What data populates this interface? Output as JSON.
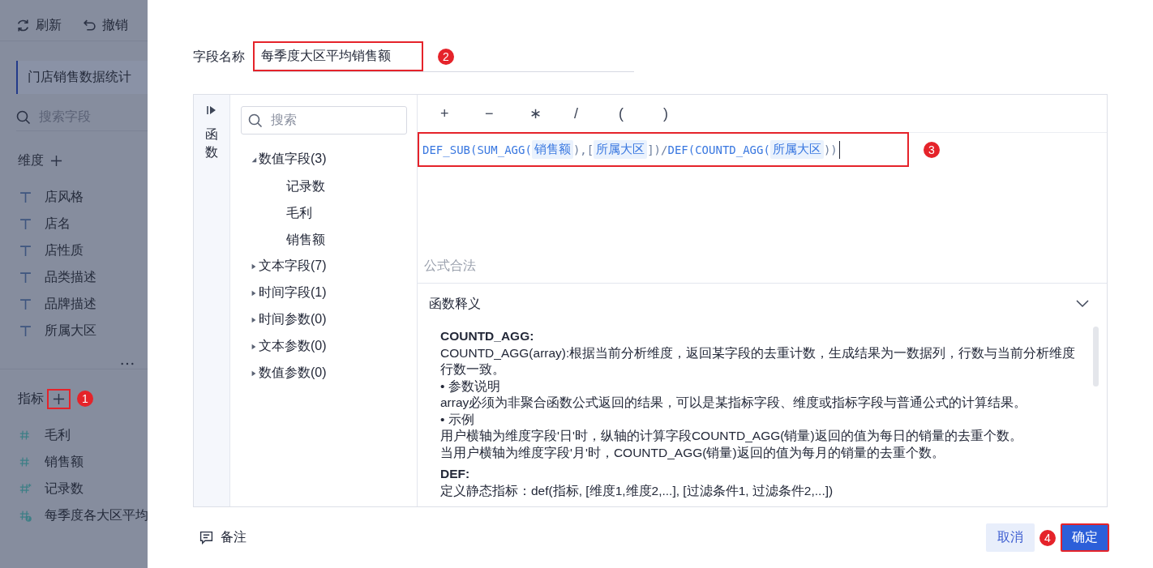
{
  "sidebar": {
    "toolbar": [
      {
        "label": "刷新",
        "kind": "refresh"
      },
      {
        "label": "撤销",
        "kind": "undo"
      }
    ],
    "tab": {
      "label": "门店销售数据统计",
      "selected": true
    },
    "search": {
      "placeholder": "搜索字段"
    },
    "dimensions": {
      "title": "维度",
      "items": [
        "店风格",
        "店名",
        "店性质",
        "品类描述",
        "品牌描述",
        "所属大区"
      ]
    },
    "measures": {
      "title": "指标",
      "highlighted": true,
      "badge": "1",
      "items": [
        {
          "label": "毛利",
          "kind": "number"
        },
        {
          "label": "销售额",
          "kind": "number"
        },
        {
          "label": "记录数",
          "kind": "count"
        },
        {
          "label": "每季度各大区平均",
          "kind": "formula"
        }
      ]
    }
  },
  "dialog": {
    "name_field": {
      "label": "字段名称",
      "value": "每季度大区平均销售额",
      "highlighted": true,
      "badge": "2"
    },
    "side_tab": {
      "label": "函数"
    },
    "field_search": {
      "placeholder": "搜索"
    },
    "field_tree": [
      {
        "label": "数值字段(3)",
        "expanded": true,
        "children": [
          {
            "label": "记录数"
          },
          {
            "label": "毛利"
          },
          {
            "label": "销售额"
          }
        ]
      },
      {
        "label": "文本字段(7)",
        "expanded": false
      },
      {
        "label": "时间字段(1)",
        "expanded": false
      },
      {
        "label": "时间参数(0)",
        "expanded": false
      },
      {
        "label": "文本参数(0)",
        "expanded": false
      },
      {
        "label": "数值参数(0)",
        "expanded": false
      }
    ],
    "operators": [
      "+",
      "−",
      "∗",
      "/",
      "(",
      ")"
    ],
    "formula": {
      "highlighted": true,
      "badge": "3",
      "tokens": [
        {
          "kind": "func",
          "text": "DEF_SUB("
        },
        {
          "kind": "func",
          "text": "SUM_AGG("
        },
        {
          "kind": "field",
          "text": "销售额"
        },
        {
          "kind": "punct",
          "text": "),["
        },
        {
          "kind": "field",
          "text": "所属大区"
        },
        {
          "kind": "punct",
          "text": "])/"
        },
        {
          "kind": "func",
          "text": "DEF("
        },
        {
          "kind": "func",
          "text": "COUNTD_AGG("
        },
        {
          "kind": "field",
          "text": "所属大区"
        },
        {
          "kind": "punct",
          "text": "))"
        }
      ]
    },
    "status": "公式合法",
    "help": {
      "title": "函数释义",
      "expanded": true,
      "entries": [
        {
          "name": "COUNTD_AGG:",
          "lines": [
            "COUNTD_AGG(array):根据当前分析维度，返回某字段的去重计数，生成结果为一数据列，行数与当前分析维度行数一致。",
            "• 参数说明",
            "array必须为非聚合函数公式返回的结果，可以是某指标字段、维度或指标字段与普通公式的计算结果。",
            "• 示例",
            "用户横轴为维度字段'日'时，纵轴的计算字段COUNTD_AGG(销量)返回的值为每日的销量的去重个数。",
            "当用户横轴为维度字段'月'时，COUNTD_AGG(销量)返回的值为每月的销量的去重个数。"
          ]
        },
        {
          "name": "DEF:",
          "lines": [
            "定义静态指标：def(指标, [维度1,维度2,...], [过滤条件1, 过滤条件2,...])"
          ]
        }
      ]
    },
    "note": {
      "label": "备注"
    },
    "buttons": [
      {
        "label": "取消",
        "kind": "secondary",
        "highlighted": false,
        "badge": "4"
      },
      {
        "label": "确定",
        "kind": "primary",
        "highlighted": true
      }
    ]
  }
}
